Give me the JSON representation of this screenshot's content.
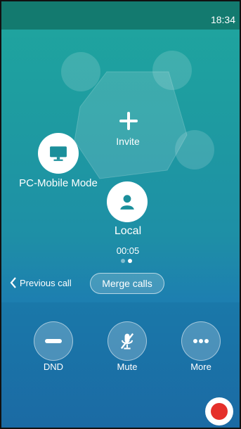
{
  "status_bar": {
    "time": "18:34"
  },
  "conference": {
    "invite_label": "Invite",
    "participants": [
      {
        "name": "PC-Mobile Mode",
        "icon": "monitor-icon"
      },
      {
        "name": "Local",
        "icon": "person-icon"
      }
    ],
    "duration": "00:05",
    "page_indicator": {
      "total": 2,
      "active": 2
    }
  },
  "actions": {
    "previous_call_label": "Previous call",
    "merge_calls_label": "Merge calls"
  },
  "controls": [
    {
      "label": "DND",
      "icon": "minus-icon"
    },
    {
      "label": "Mute",
      "icon": "mic-off-icon"
    },
    {
      "label": "More",
      "icon": "more-icon"
    }
  ],
  "record": {
    "icon": "record-icon",
    "color": "#e5302b"
  },
  "colors": {
    "statusbar": "#137a6f",
    "record": "#e5302b"
  }
}
